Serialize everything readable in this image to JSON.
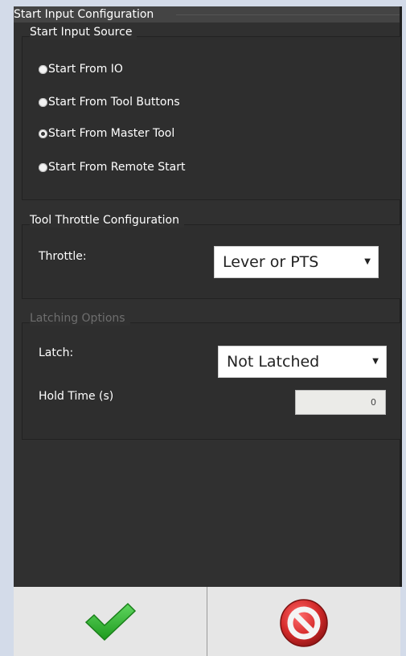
{
  "panel": {
    "title": "Start Input Configuration"
  },
  "start_source": {
    "legend": "Start Input Source",
    "options": [
      {
        "label": "Start From IO",
        "checked": false
      },
      {
        "label": "Start From Tool Buttons",
        "checked": false
      },
      {
        "label": "Start From Master Tool",
        "checked": true
      },
      {
        "label": "Start From Remote Start",
        "checked": false
      }
    ]
  },
  "throttle": {
    "legend": "Tool Throttle Configuration",
    "label": "Throttle:",
    "value": "Lever or PTS"
  },
  "latching": {
    "legend": "Latching Options",
    "latch_label": "Latch:",
    "latch_value": "Not Latched",
    "hold_label": "Hold Time (s)",
    "hold_value": "0"
  },
  "footer": {
    "ok_icon": "checkmark-icon",
    "cancel_icon": "cancel-icon",
    "ok_color": "#2eb82e",
    "cancel_color": "#d42a2a"
  }
}
